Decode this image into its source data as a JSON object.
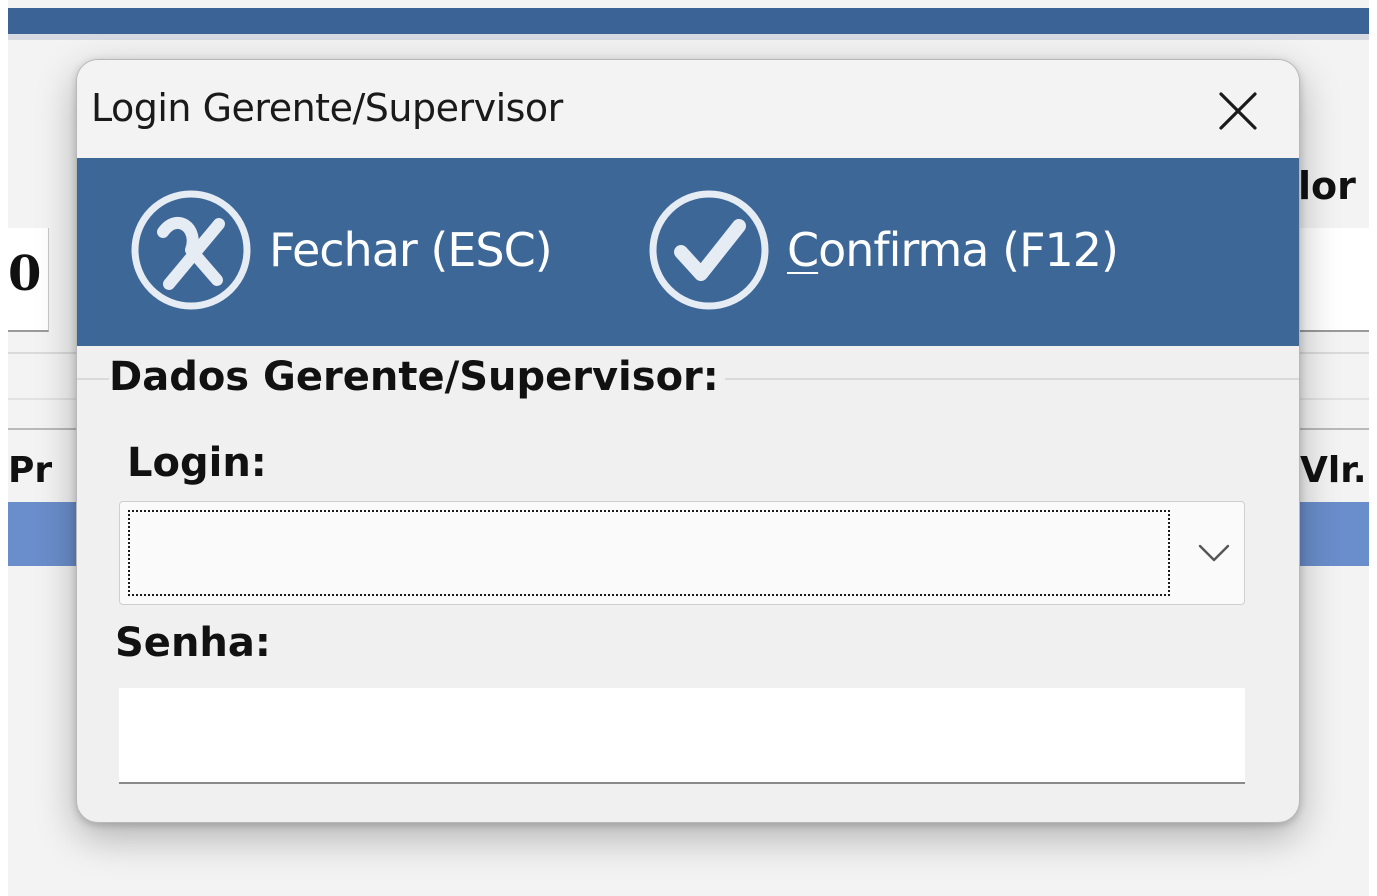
{
  "background_app": {
    "field_value_left": "0",
    "label_right_top": "lor",
    "grid_header_left": "Pr",
    "grid_header_right": "Vlr."
  },
  "dialog": {
    "title": "Login Gerente/Supervisor",
    "close_icon": "close-icon",
    "toolbar": {
      "close_button": {
        "label": "Fechar (ESC)",
        "icon": "x-circle-icon"
      },
      "confirm_button": {
        "label_first_char": "C",
        "label_rest": "onfirma (F12)",
        "icon": "check-circle-icon"
      }
    },
    "group_title": "Dados Gerente/Supervisor:",
    "login": {
      "label": "Login:",
      "value": "",
      "placeholder": ""
    },
    "senha": {
      "label": "Senha:",
      "value": "",
      "placeholder": ""
    }
  },
  "colors": {
    "toolbar_bg": "#3d6797",
    "app_titlebar": "#3b6395",
    "selected_row": "#6a8ecb",
    "dialog_bg": "#f0f0f0"
  }
}
